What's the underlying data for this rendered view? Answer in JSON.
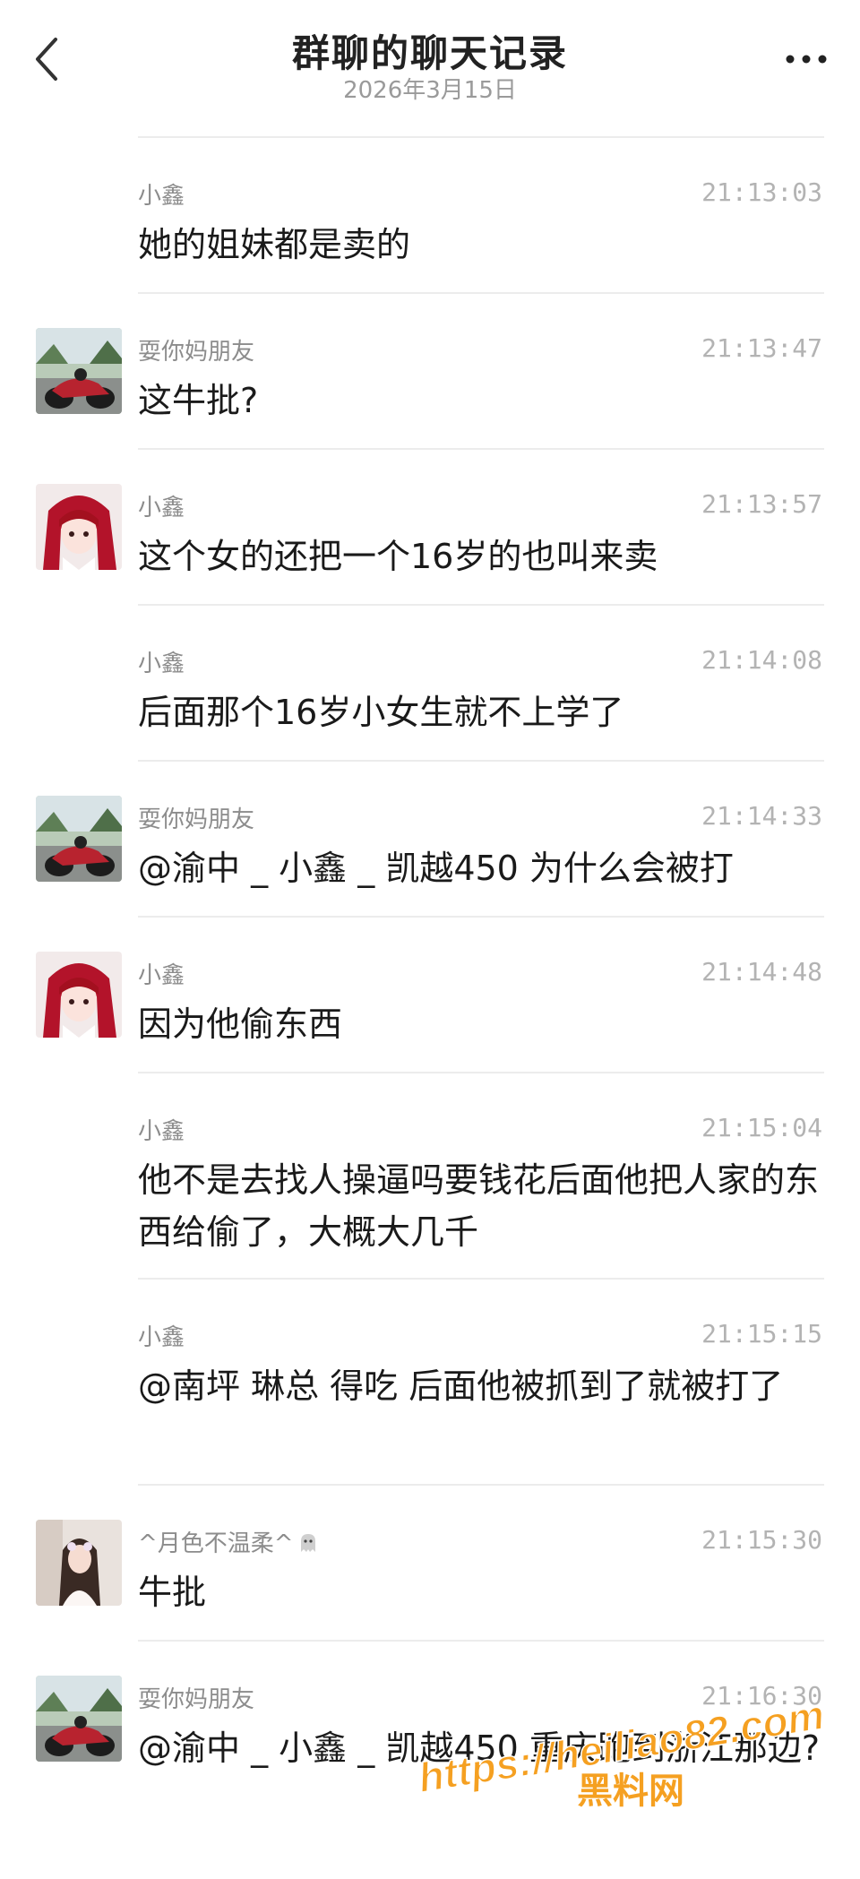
{
  "header": {
    "title": "群聊的聊天记录",
    "date": "2026年3月15日"
  },
  "icons": {
    "back": "chevron-left-icon",
    "more": "more-dots-icon"
  },
  "colors": {
    "background": "#ffffff",
    "primary_text": "#1a1a1a",
    "secondary_text": "#8c8c8c",
    "timestamp": "#b3b3b3",
    "watermark": "#f5a021"
  },
  "messages": [
    {
      "sender": "小鑫",
      "time": "21:13:03",
      "text": "她的姐妹都是卖的",
      "avatar": "none"
    },
    {
      "sender": "耍你妈朋友",
      "time": "21:13:47",
      "text": "这牛批?",
      "avatar": "motorcycle"
    },
    {
      "sender": "小鑫",
      "time": "21:13:57",
      "text": "这个女的还把一个16岁的也叫来卖",
      "avatar": "anime-girl"
    },
    {
      "sender": "小鑫",
      "time": "21:14:08",
      "text": "后面那个16岁小女生就不上学了",
      "avatar": "none"
    },
    {
      "sender": "耍你妈朋友",
      "time": "21:14:33",
      "text": "@渝中 _ 小鑫 _ 凯越450 为什么会被打",
      "avatar": "motorcycle"
    },
    {
      "sender": "小鑫",
      "time": "21:14:48",
      "text": "因为他偷东西",
      "avatar": "anime-girl"
    },
    {
      "sender": "小鑫",
      "time": "21:15:04",
      "text": "他不是去找人操逼吗要钱花后面他把人家的东西给偷了，大概大几千",
      "avatar": "none"
    },
    {
      "sender": "小鑫",
      "time": "21:15:15",
      "text": "@南坪  琳总  得吃 后面他被抓到了就被打了",
      "avatar": "none"
    },
    {
      "sender": "^月色不温柔^",
      "time": "21:15:30",
      "text": "牛批",
      "avatar": "girl-photo"
    },
    {
      "sender": "耍你妈朋友",
      "time": "21:16:30",
      "text": "@渝中 _ 小鑫 _ 凯越450 重庆跑到浙江那边?",
      "avatar": "motorcycle"
    }
  ],
  "watermark": {
    "url": "https://heiliao82.com",
    "label": "黑料网"
  }
}
